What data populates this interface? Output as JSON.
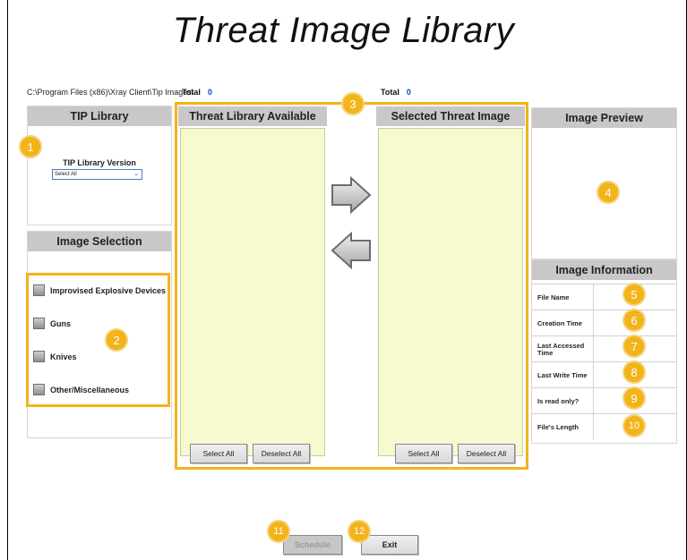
{
  "title": "Threat Image Library",
  "path": "C:\\Program Files (x86)\\Xray Client\\Tip Images\\",
  "totals": [
    {
      "label": "Total",
      "value": "0"
    },
    {
      "label": "Total",
      "value": "0"
    }
  ],
  "tip_library": {
    "header": "TIP Library",
    "version_label": "TIP Library Version",
    "version_value": "Select All"
  },
  "image_selection": {
    "header": "Image Selection",
    "items": [
      {
        "label": "Improvised Explosive Devices",
        "checked": false
      },
      {
        "label": "Guns",
        "checked": false
      },
      {
        "label": "Knives",
        "checked": false
      },
      {
        "label": "Other/Miscellaneous",
        "checked": false
      }
    ]
  },
  "threat_available": {
    "header": "Threat Library Available",
    "select_all": "Select All",
    "deselect_all": "Deselect All"
  },
  "threat_selected": {
    "header": "Selected Threat Image",
    "select_all": "Select All",
    "deselect_all": "Deselect All"
  },
  "image_preview": {
    "header": "Image Preview"
  },
  "image_information": {
    "header": "Image Information",
    "rows": [
      {
        "label": "File Name",
        "value": ""
      },
      {
        "label": "Creation  Time",
        "value": ""
      },
      {
        "label": "Last Accessed Time",
        "value": ""
      },
      {
        "label": "Last Write Time",
        "value": ""
      },
      {
        "label": "Is read only?",
        "value": ""
      },
      {
        "label": "File's Length",
        "value": ""
      }
    ]
  },
  "buttons": {
    "schedule": "Schedule",
    "exit": "Exit"
  },
  "callouts": [
    "1",
    "2",
    "3",
    "4",
    "5",
    "6",
    "7",
    "8",
    "9",
    "10",
    "11",
    "12"
  ],
  "colors": {
    "callout": "#f2b31b",
    "listbox": "#f7f9cf",
    "header": "#c8c8c8",
    "total_value": "#1a3fcc"
  }
}
